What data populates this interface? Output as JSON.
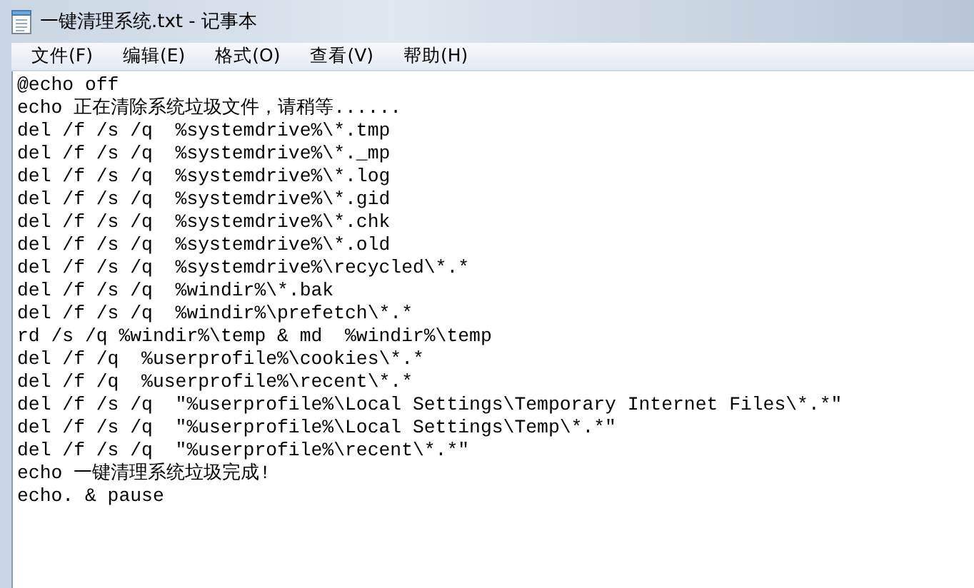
{
  "window": {
    "title": "一键清理系统.txt - 记事本"
  },
  "menu": [
    {
      "label": "文件(F)"
    },
    {
      "label": "编辑(E)"
    },
    {
      "label": "格式(O)"
    },
    {
      "label": "查看(V)"
    },
    {
      "label": "帮助(H)"
    }
  ],
  "editor": {
    "lines": [
      "@echo off",
      "echo 正在清除系统垃圾文件，请稍等......",
      "del /f /s /q  %systemdrive%\\*.tmp",
      "del /f /s /q  %systemdrive%\\*._mp",
      "del /f /s /q  %systemdrive%\\*.log",
      "del /f /s /q  %systemdrive%\\*.gid",
      "del /f /s /q  %systemdrive%\\*.chk",
      "del /f /s /q  %systemdrive%\\*.old",
      "del /f /s /q  %systemdrive%\\recycled\\*.*",
      "del /f /s /q  %windir%\\*.bak",
      "del /f /s /q  %windir%\\prefetch\\*.*",
      "rd /s /q %windir%\\temp & md  %windir%\\temp",
      "del /f /q  %userprofile%\\cookies\\*.*",
      "del /f /q  %userprofile%\\recent\\*.*",
      "del /f /s /q  \"%userprofile%\\Local Settings\\Temporary Internet Files\\*.*\"",
      "del /f /s /q  \"%userprofile%\\Local Settings\\Temp\\*.*\"",
      "del /f /s /q  \"%userprofile%\\recent\\*.*\"",
      "echo 一键清理系统垃圾完成!",
      "echo. & pause"
    ]
  }
}
